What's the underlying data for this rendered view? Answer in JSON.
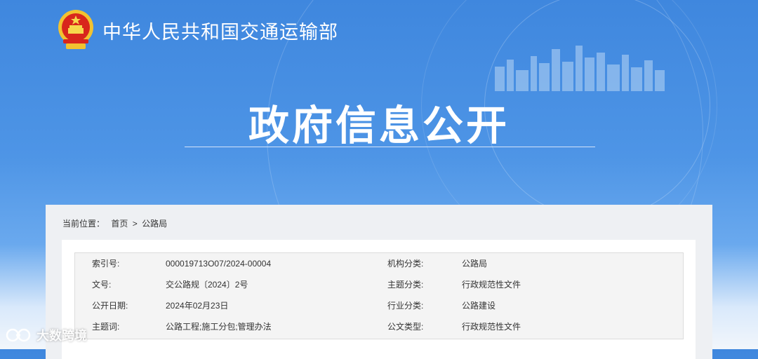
{
  "header": {
    "ministry_name": "中华人民共和国交通运输部",
    "page_title": "政府信息公开"
  },
  "breadcrumb": {
    "prefix": "当前位置：",
    "home": "首页",
    "separator": ">",
    "current": "公路局"
  },
  "meta": [
    {
      "k1": "索引号:",
      "v1": "000019713O07/2024-00004",
      "k2": "机构分类:",
      "v2": "公路局"
    },
    {
      "k1": "文号:",
      "v1": "交公路规〔2024〕2号",
      "k2": "主题分类:",
      "v2": "行政规范性文件"
    },
    {
      "k1": "公开日期:",
      "v1": "2024年02月23日",
      "k2": "行业分类:",
      "v2": "公路建设"
    },
    {
      "k1": "主题词:",
      "v1": "公路工程;施工分包;管理办法",
      "k2": "公文类型:",
      "v2": "行政规范性文件"
    }
  ],
  "watermark": {
    "text": "大数跨境"
  },
  "colors": {
    "banner": "#4a90e2",
    "panel": "#eef0f3",
    "meta_bg": "#f4f4f4"
  }
}
